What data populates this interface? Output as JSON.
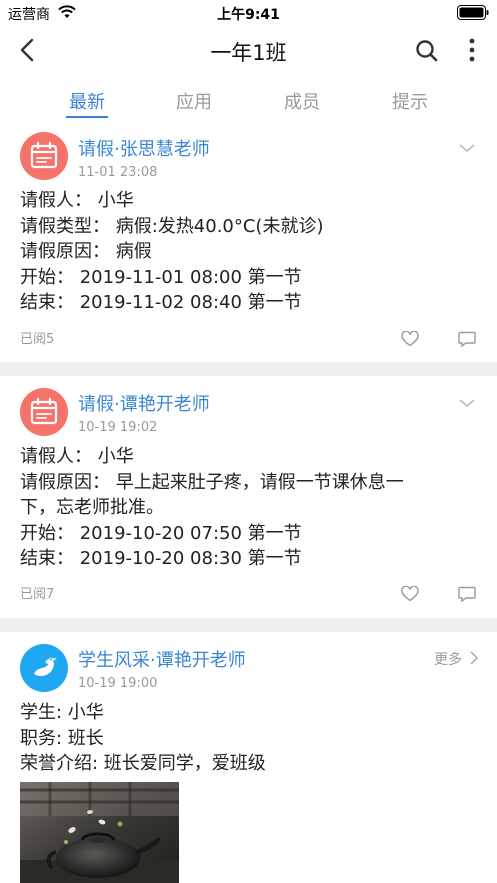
{
  "status_bar": {
    "carrier": "运营商",
    "time": "上午9:41"
  },
  "nav": {
    "title": "一年1班"
  },
  "tabs": [
    {
      "label": "最新",
      "active": true
    },
    {
      "label": "应用",
      "active": false
    },
    {
      "label": "成员",
      "active": false
    },
    {
      "label": "提示",
      "active": false
    }
  ],
  "posts": [
    {
      "title": "请假·张思慧老师",
      "time": "11-01 23:08",
      "lines": [
        "请假人：  小华",
        "请假类型：  病假:发热40.0°C(未就诊)",
        "请假原因：  病假",
        "开始：  2019-11-01 08:00 第一节",
        "结束：  2019-11-02 08:40 第一节"
      ],
      "read": "已阅5"
    },
    {
      "title": "请假·谭艳开老师",
      "time": "10-19 19:02",
      "lines": [
        "请假人：  小华",
        "请假原因：  早上起来肚子疼，请假一节课休息一",
        "下，忘老师批准。",
        "开始：  2019-10-20 07:50 第一节",
        "结束：  2019-10-20 08:30 第一节"
      ],
      "read": "已阅7"
    },
    {
      "title": "学生风采·谭艳开老师",
      "time": "10-19 19:00",
      "more": "更多",
      "lines": [
        "学生: 小华",
        "职务: 班长",
        "荣誉介绍: 班长爱同学，爱班级"
      ]
    }
  ],
  "colors": {
    "accent": "#3b82d6",
    "leave_icon_bg": "#f4736b",
    "style_icon_bg": "#1fa7f2",
    "separator": "#eeeff2"
  },
  "icons": [
    "back-arrow-icon",
    "search-icon",
    "more-vertical-icon",
    "calendar-icon",
    "chevron-down-icon",
    "heart-icon",
    "comment-icon",
    "bird-icon",
    "chevron-right-icon"
  ]
}
